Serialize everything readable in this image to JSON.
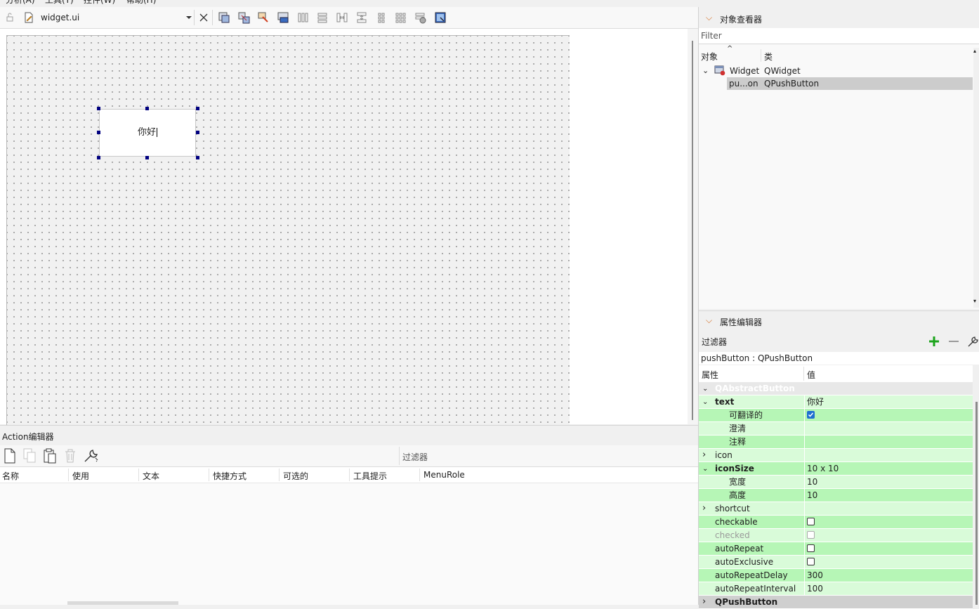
{
  "menubar": {
    "items": [
      "分析(A)",
      "工具(T)",
      "控件(W)",
      "帮助(H)"
    ]
  },
  "editor_toolbar": {
    "file_name": "widget.ui",
    "icons": [
      "lock-icon",
      "file-edit-icon",
      "dropdown-arrow-icon",
      "close-icon",
      "edit-widgets-icon",
      "edit-signals-icon",
      "edit-buddies-icon",
      "edit-tab-order-icon",
      "layout-horizontal-icon",
      "layout-vertical-icon",
      "layout-horizontal-splitter-icon",
      "layout-vertical-splitter-icon",
      "layout-form-icon",
      "layout-grid-icon",
      "break-layout-icon",
      "adjust-size-icon"
    ]
  },
  "form": {
    "button_text": "你好"
  },
  "action_editor": {
    "title": "Action编辑器",
    "filter_placeholder": "过滤器",
    "columns": [
      "名称",
      "使用",
      "文本",
      "快捷方式",
      "可选的",
      "工具提示",
      "MenuRole"
    ],
    "icons": [
      "new-action-icon",
      "copy-action-icon",
      "paste-action-icon",
      "delete-action-icon",
      "configure-icon"
    ]
  },
  "object_inspector": {
    "title": "对象查看器",
    "filter_placeholder": "Filter",
    "columns": {
      "object": "对象",
      "class": "类"
    },
    "rows": [
      {
        "object": "Widget",
        "class": "QWidget",
        "expanded": true,
        "selected": false
      },
      {
        "object": "pu...on",
        "class": "QPushButton",
        "selected": true
      }
    ]
  },
  "property_editor": {
    "title": "属性编辑器",
    "filter_placeholder": "过滤器",
    "object_class": "pushButton : QPushButton",
    "columns": {
      "property": "属性",
      "value": "值"
    },
    "rows": [
      {
        "name": "QAbstractButton",
        "value": "",
        "type": "group"
      },
      {
        "name": "text",
        "value": "你好",
        "bold": true,
        "expander": "open",
        "bg": "#d9fbd9"
      },
      {
        "name": "可翻译的",
        "value": "",
        "checkbox": "checked",
        "indent": true,
        "bg": "#b6f6b6"
      },
      {
        "name": "澄清",
        "value": "",
        "indent": true,
        "bg": "#d9fbd9"
      },
      {
        "name": "注释",
        "value": "",
        "indent": true,
        "bg": "#b6f6b6"
      },
      {
        "name": "icon",
        "value": "",
        "expander": "closed",
        "bg": "#d9fbd9"
      },
      {
        "name": "iconSize",
        "value": "10 x 10",
        "bold": true,
        "expander": "open",
        "bg": "#b6f6b6"
      },
      {
        "name": "宽度",
        "value": "10",
        "indent": true,
        "bg": "#d9fbd9"
      },
      {
        "name": "高度",
        "value": "10",
        "indent": true,
        "bg": "#b6f6b6"
      },
      {
        "name": "shortcut",
        "value": "",
        "expander": "closed",
        "bg": "#d9fbd9"
      },
      {
        "name": "checkable",
        "value": "",
        "checkbox": "unchecked",
        "bg": "#b6f6b6"
      },
      {
        "name": "checked",
        "value": "",
        "checkbox": "disabled",
        "disabled": true,
        "bg": "#d9fbd9"
      },
      {
        "name": "autoRepeat",
        "value": "",
        "checkbox": "unchecked",
        "bg": "#b6f6b6"
      },
      {
        "name": "autoExclusive",
        "value": "",
        "checkbox": "unchecked",
        "bg": "#d9fbd9"
      },
      {
        "name": "autoRepeatDelay",
        "value": "300",
        "bg": "#b6f6b6"
      },
      {
        "name": "autoRepeatInterval",
        "value": "100",
        "bg": "#d9fbd9"
      },
      {
        "name": "QPushButton",
        "value": "",
        "type": "group2",
        "expander": "closed"
      }
    ]
  }
}
